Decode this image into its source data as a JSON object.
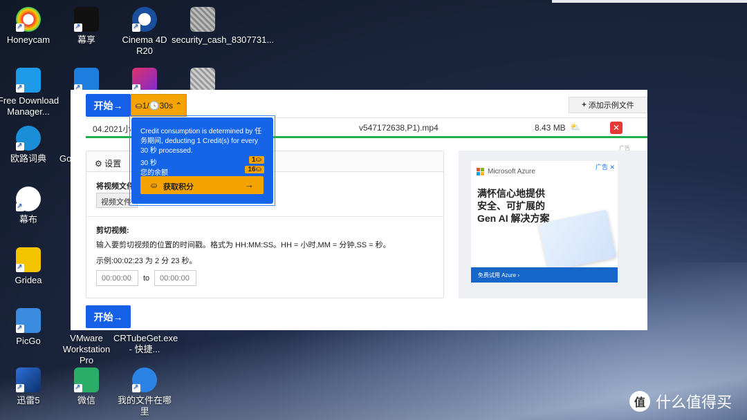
{
  "desktop": {
    "icons": [
      {
        "label": "Honeycam"
      },
      {
        "label": "幕享"
      },
      {
        "label": "Cinema 4D R20"
      },
      {
        "label": "security_cash_8307731..."
      },
      {
        "label": "Free Download Manager..."
      },
      {
        "label": ""
      },
      {
        "label": ""
      },
      {
        "label": ""
      },
      {
        "label": "欧路词典"
      },
      {
        "label": "Go"
      },
      {
        "label": "幕布"
      },
      {
        "label": "Gridea"
      },
      {
        "label": "PicGo"
      },
      {
        "label": "VMware Workstation Pro"
      },
      {
        "label": "CRTubeGet.exe - 快捷..."
      },
      {
        "label": "迅雷5"
      },
      {
        "label": "微信"
      },
      {
        "label": "我的文件在哪里"
      }
    ],
    "brand": "什么值得买"
  },
  "app": {
    "start_label": "开始→",
    "credit_button": "⛀1/🕓30s ⌃",
    "add_example": "添加示例文件",
    "file": {
      "name_start": "04.2021小睡",
      "name_end": "v547172638,P1).mp4",
      "size": "8.43 MB"
    },
    "ad_small_tag": "广告",
    "settings": {
      "title": "设置",
      "convert_label": "将视频文件",
      "select_value": "视频文件",
      "cut_title": "剪切视频:",
      "cut_desc": "输入要剪切视频的位置的时间戳。格式为 HH:MM:SS。HH = 小时,MM = 分钟,SS = 秒。",
      "example": "示例:00:02:23 为 2 分 23 秒。",
      "start_time_placeholder": "00:00:00",
      "to": "to",
      "end_time_placeholder": "00:00:00"
    },
    "tooltip": {
      "message": "Credit consumption is determined by 任务期间, deducting 1 Credit(s) for every 30 秒 processed.",
      "row1_label": "30 秒",
      "row1_value": "1⛀",
      "row2_label": "您的余额",
      "row2_value": "16⛀",
      "get_button": "获取积分"
    },
    "ad": {
      "brand": "Microsoft Azure",
      "tag": "广告 ✕",
      "headline": "满怀信心地提供安全、可扩展的 Gen AI 解决方案",
      "cta": "免费试用 Azure ›"
    }
  },
  "colors": {
    "primary": "#1560e6",
    "accent": "#f5a300",
    "progress": "#20b04b",
    "danger": "#e53935"
  }
}
